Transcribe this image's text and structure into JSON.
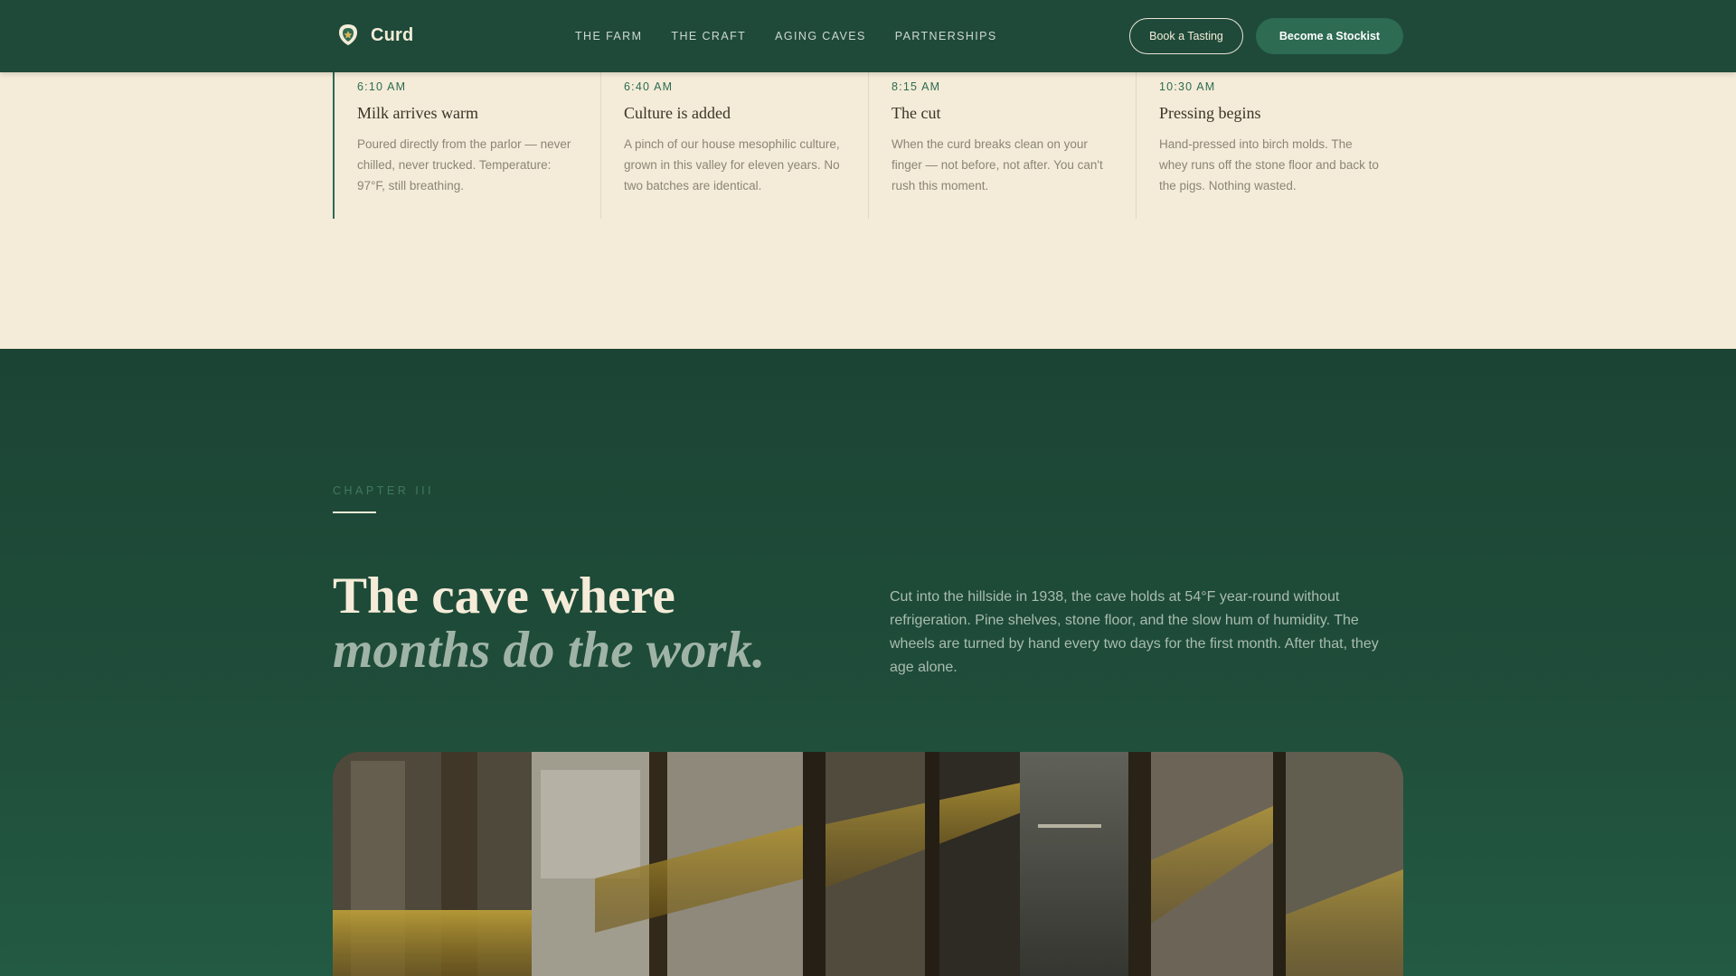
{
  "header": {
    "brand": "Curd",
    "nav": [
      "THE FARM",
      "THE CRAFT",
      "AGING CAVES",
      "PARTNERSHIPS"
    ],
    "book_tasting": "Book a Tasting",
    "become_stockist": "Become a Stockist"
  },
  "timeline": [
    {
      "time": "6:10 AM",
      "title": "Milk arrives warm",
      "body": "Poured directly from the parlor — never chilled, never trucked. Temperature: 97°F, still breathing."
    },
    {
      "time": "6:40 AM",
      "title": "Culture is added",
      "body": "A pinch of our house mesophilic culture, grown in this valley for eleven years. No two batches are identical."
    },
    {
      "time": "8:15 AM",
      "title": "The cut",
      "body": "When the curd breaks clean on your finger — not before, not after. You can't rush this moment."
    },
    {
      "time": "10:30 AM",
      "title": "Pressing begins",
      "body": "Hand-pressed into birch molds. The whey runs off the stone floor and back to the pigs. Nothing wasted."
    }
  ],
  "cave": {
    "chapter": "CHAPTER III",
    "headline_1": "The cave where",
    "headline_2": "months do the work.",
    "description": "Cut into the hillside in 1938, the cave holds at 54°F year-round without refrigeration. Pine shelves, stone floor, and the slow hum of humidity. The wheels are turned by hand every two days for the first month. After that, they age alone."
  },
  "colors": {
    "header_bg": "#1f4a3a",
    "cream": "#f4ecd8",
    "accent_green": "#2d6b52",
    "cave_bg": "#1f4d3a"
  }
}
